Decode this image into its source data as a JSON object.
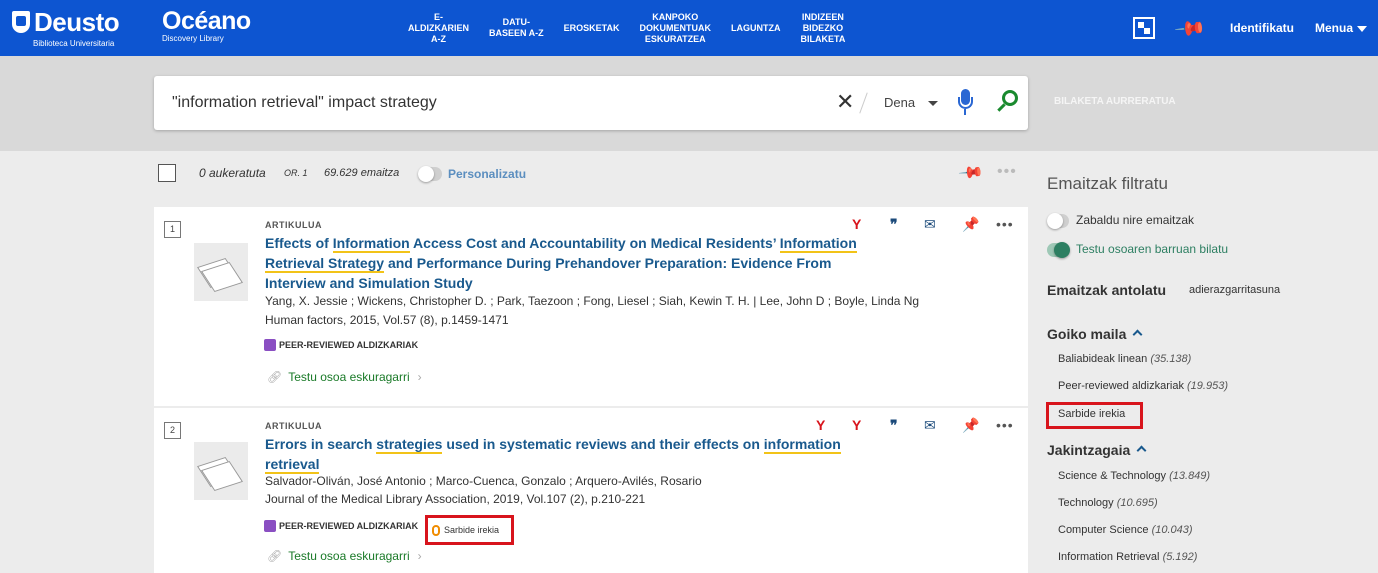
{
  "header": {
    "logo_main": "Deusto",
    "logo_sub": "Biblioteca Universitaria",
    "discovery_title": "Océano",
    "discovery_sub": "Discovery Library",
    "nav": [
      "E-\nALDIZKARIEN\nA-Z",
      "DATU-\nBASEEN A-Z",
      "EROSKETAK",
      "KANPOKO\nDOKUMENTUAK\nESKURATZEA",
      "LAGUNTZA",
      "INDIZEEN\nBIDEZKO\nBILAKETA"
    ],
    "signin": "Identifikatu",
    "menu": "Menua"
  },
  "search": {
    "query": "\"information retrieval\" impact strategy",
    "scope": "Dena",
    "advanced": "BILAKETA AURRERATUA"
  },
  "results_header": {
    "selected": "0 aukeratuta",
    "page": "OR. 1",
    "total": "69.629 emaitza",
    "personalize": "Personalizatu"
  },
  "results": [
    {
      "num": "1",
      "type": "ARTIKULUA",
      "title_parts": [
        {
          "t": "Effects of ",
          "hl": false
        },
        {
          "t": "Information",
          "hl": true
        },
        {
          "t": " Access Cost and Accountability on Medical Residents’ ",
          "hl": false
        },
        {
          "t": "Information Retrieval Strategy",
          "hl": true
        },
        {
          "t": " and Performance During Prehandover Preparation: Evidence From Interview and Simulation Study",
          "hl": false
        }
      ],
      "authors": "Yang, X. Jessie ; Wickens, Christopher D. ; Park, Taezoon ; Fong, Liesel ; Siah, Kewin T. H. | Lee, John D ; Boyle, Linda Ng",
      "source": "Human factors, 2015, Vol.57 (8), p.1459-1471",
      "peer": "PEER-REVIEWED ALDIZKARIAK",
      "fulltext": "Testu osoa eskuragarri"
    },
    {
      "num": "2",
      "type": "ARTIKULUA",
      "title_parts": [
        {
          "t": "Errors in search ",
          "hl": false
        },
        {
          "t": "strategies",
          "hl": true
        },
        {
          "t": " used in systematic reviews and their effects on ",
          "hl": false
        },
        {
          "t": "information retrieval",
          "hl": true
        }
      ],
      "authors": "Salvador-Oliván, José Antonio ; Marco-Cuenca, Gonzalo ; Arquero-Avilés, Rosario",
      "source": "Journal of the Medical Library Association, 2019, Vol.107 (2), p.210-221",
      "peer": "PEER-REVIEWED ALDIZKARIAK",
      "open_access": "Sarbide irekia",
      "fulltext": "Testu osoa eskuragarri"
    }
  ],
  "sidebar": {
    "title": "Emaitzak filtratu",
    "toggle1": "Zabaldu nire emaitzak",
    "toggle2": "Testu osoaren barruan bilatu",
    "sort_label": "Emaitzak antolatu",
    "sort_value": "adierazgarritasuna",
    "section1": "Goiko maila",
    "s1_items": [
      {
        "label": "Baliabideak linean",
        "count": "(35.138)"
      },
      {
        "label": "Peer-reviewed aldizkariak",
        "count": "(19.953)"
      },
      {
        "label": "Sarbide irekia",
        "count": ""
      }
    ],
    "section2": "Jakintzagaia",
    "s2_items": [
      {
        "label": "Science & Technology",
        "count": "(13.849)"
      },
      {
        "label": "Technology",
        "count": "(10.695)"
      },
      {
        "label": "Computer Science",
        "count": "(10.043)"
      },
      {
        "label": "Information Retrieval",
        "count": "(5.192)"
      }
    ]
  },
  "colors": {
    "brand_blue": "#0d55d1",
    "highlight_box": "#d8141c",
    "link_title": "#19598d",
    "fulltext_green": "#1a7a28"
  },
  "icons": [
    "search-icon",
    "clear-icon",
    "microphone-icon",
    "qr-code-icon",
    "pin-icon",
    "more-icon",
    "citation-icon",
    "email-icon",
    "citation-trail-icon",
    "link-icon",
    "open-access-icon"
  ]
}
